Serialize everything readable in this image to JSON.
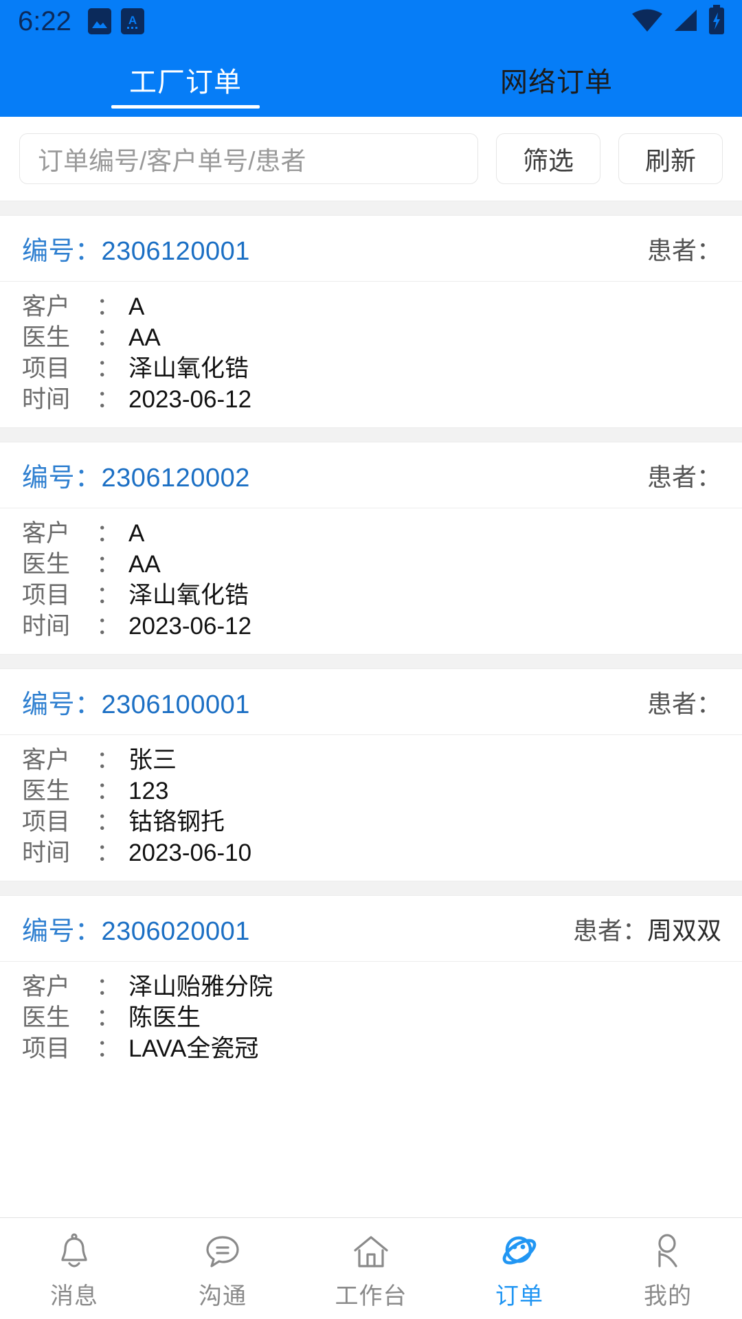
{
  "statusbar": {
    "clock": "6:22",
    "icons": [
      "image-icon",
      "app-icon",
      "wifi-icon",
      "signal-icon",
      "battery-charging-icon"
    ]
  },
  "tabs": [
    {
      "label": "工厂订单",
      "active": true
    },
    {
      "label": "网络订单",
      "active": false
    }
  ],
  "search": {
    "placeholder": "订单编号/客户单号/患者",
    "value": "",
    "filter_label": "筛选",
    "refresh_label": "刷新"
  },
  "labels": {
    "order_no": "编号：",
    "patient": "患者：",
    "customer": "客户",
    "doctor": "医生",
    "project": "项目",
    "time": "时间",
    "colon": "："
  },
  "orders": [
    {
      "no": "2306120001",
      "patient": "",
      "customer": "A",
      "doctor": "AA",
      "project": "泽山氧化锆",
      "time": "2023-06-12"
    },
    {
      "no": "2306120002",
      "patient": "",
      "customer": "A",
      "doctor": "AA",
      "project": "泽山氧化锆",
      "time": "2023-06-12"
    },
    {
      "no": "2306100001",
      "patient": "",
      "customer": "张三",
      "doctor": "123",
      "project": "钴铬钢托",
      "time": "2023-06-10"
    },
    {
      "no": "2306020001",
      "patient": "周双双",
      "customer": "泽山贻雅分院",
      "doctor": "陈医生",
      "project": "LAVA全瓷冠",
      "time": ""
    }
  ],
  "bottomnav": [
    {
      "label": "消息",
      "icon": "bell-icon",
      "active": false
    },
    {
      "label": "沟通",
      "icon": "chat-bubble-icon",
      "active": false
    },
    {
      "label": "工作台",
      "icon": "home-icon",
      "active": false
    },
    {
      "label": "订单",
      "icon": "planet-icon",
      "active": true
    },
    {
      "label": "我的",
      "icon": "person-icon",
      "active": false
    }
  ],
  "colors": {
    "brand_blue": "#067DF7",
    "accent_blue": "#2196F3",
    "link_blue": "#1b6fc4",
    "status_icon": "#0b2a5b",
    "divider": "#ececec",
    "gap_gray": "#f2f2f2"
  }
}
